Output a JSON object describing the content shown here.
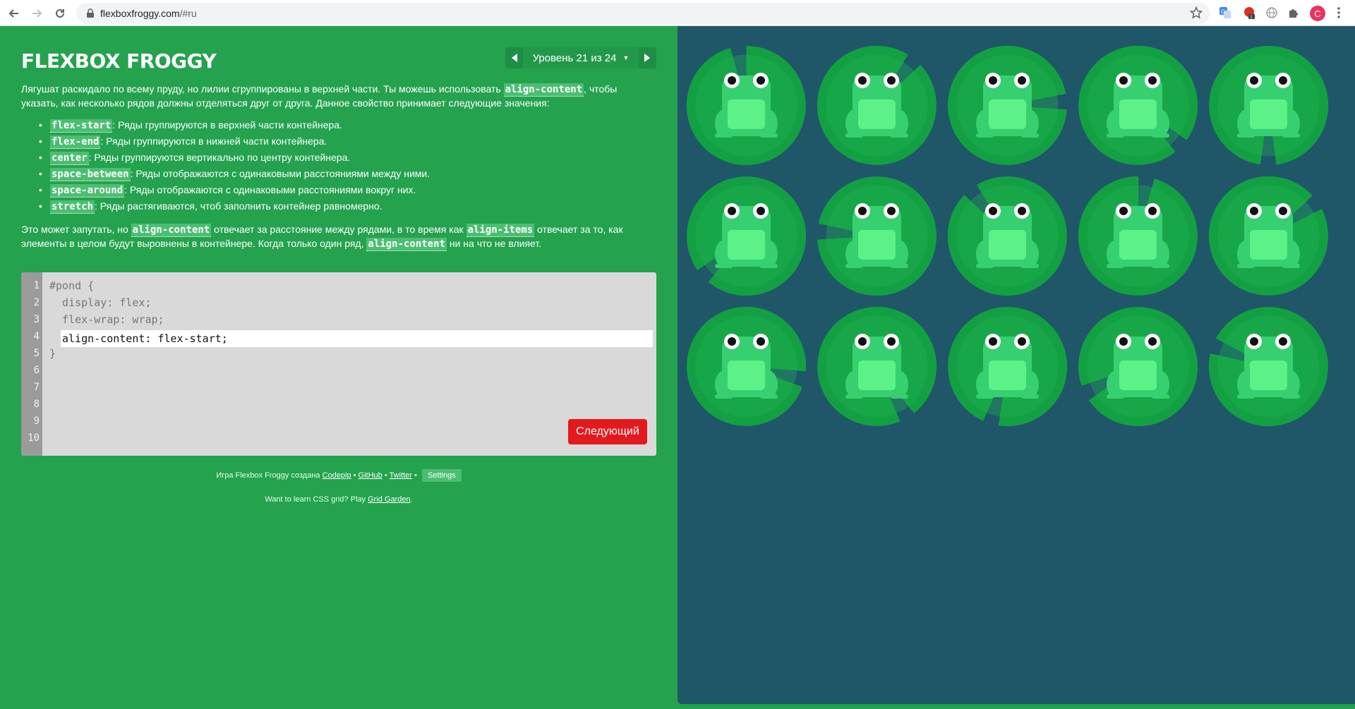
{
  "browser": {
    "url_host": "flexboxfroggy.com",
    "url_path": "/#ru",
    "avatar_letter": "C"
  },
  "header": {
    "logo": "FLEXBOX FROGGY",
    "level_label": "Уровень 21 из 24"
  },
  "instructions": {
    "intro_part1": "Лягушат раскидало по всему пруду, но лилии сгруппированы в верхней части. Ты можешь использовать ",
    "intro_code": "align-content",
    "intro_part2": ", чтобы указать, как несколько рядов должны отделяться друг от друга. Данное свойство принимает следующие значения:",
    "values": [
      {
        "code": "flex-start",
        "text": ": Ряды группируются в верхней части контейнера."
      },
      {
        "code": "flex-end",
        "text": ": Ряды группируются в нижней части контейнера."
      },
      {
        "code": "center",
        "text": ": Ряды группируются вертикально по центру контейнера."
      },
      {
        "code": "space-between",
        "text": ": Ряды отображаются с одинаковыми расстояниями между ними."
      },
      {
        "code": "space-around",
        "text": ": Ряды отображаются с одинаковыми расстояниями вокруг них."
      },
      {
        "code": "stretch",
        "text": ": Ряды растягиваются, чтоб заполнить контейнер равномерно."
      }
    ],
    "extra_part1": "Это может запутать, но ",
    "extra_code1": "align-content",
    "extra_part2": " отвечает за расстояние между рядами, в то время как ",
    "extra_code2": "align-items",
    "extra_part3": " отвечает за то, как элементы в целом будут выровнены в контейнере. Когда только один ряд, ",
    "extra_code3": "align-content",
    "extra_part4": " ни на что не влияет."
  },
  "editor": {
    "line_numbers": [
      "1",
      "2",
      "3",
      "4",
      "5",
      "6",
      "7",
      "8",
      "9",
      "10"
    ],
    "line1": "#pond {",
    "line2": "  display: flex;",
    "line3": "  flex-wrap: wrap;",
    "input_value": "align-content: flex-start;",
    "line5": "}",
    "next_button": "Следующий"
  },
  "credits": {
    "prefix": "Игра Flexbox Froggy создана ",
    "codepip": "Codepip",
    "sep1": " • ",
    "github": "GitHub",
    "sep2": " • ",
    "twitter": "Twitter",
    "sep3": " • ",
    "settings": "Settings"
  },
  "footer": {
    "prefix": "Want to learn CSS grid? Play ",
    "link": "Grid Garden",
    "suffix": "."
  },
  "pond": {
    "colors": {
      "water": "#1f5768",
      "lilypad": "#13a043",
      "lilypad_inner": "#1fb554",
      "frog_body": "#37d071",
      "frog_belly": "#5cf287"
    },
    "frog_count": 15
  }
}
